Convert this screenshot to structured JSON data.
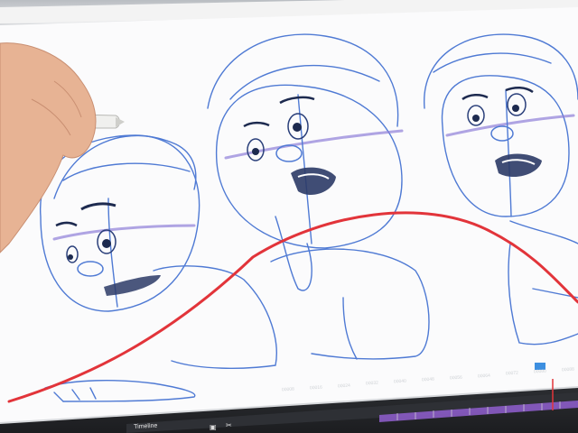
{
  "timeline": {
    "title": "Timeline",
    "frame_labels": [
      "00008",
      "00016",
      "00024",
      "00032",
      "00040",
      "00048",
      "00056",
      "00064",
      "00072",
      "00080",
      "00088"
    ]
  },
  "colors": {
    "sketch_blue": "#3f6fc9",
    "arc_red": "#e2343a",
    "playhead": "#e2343a",
    "track_purple": "#8b5cc7"
  },
  "icons": [
    "scissors-icon",
    "layer-icon",
    "stylus-icon"
  ]
}
